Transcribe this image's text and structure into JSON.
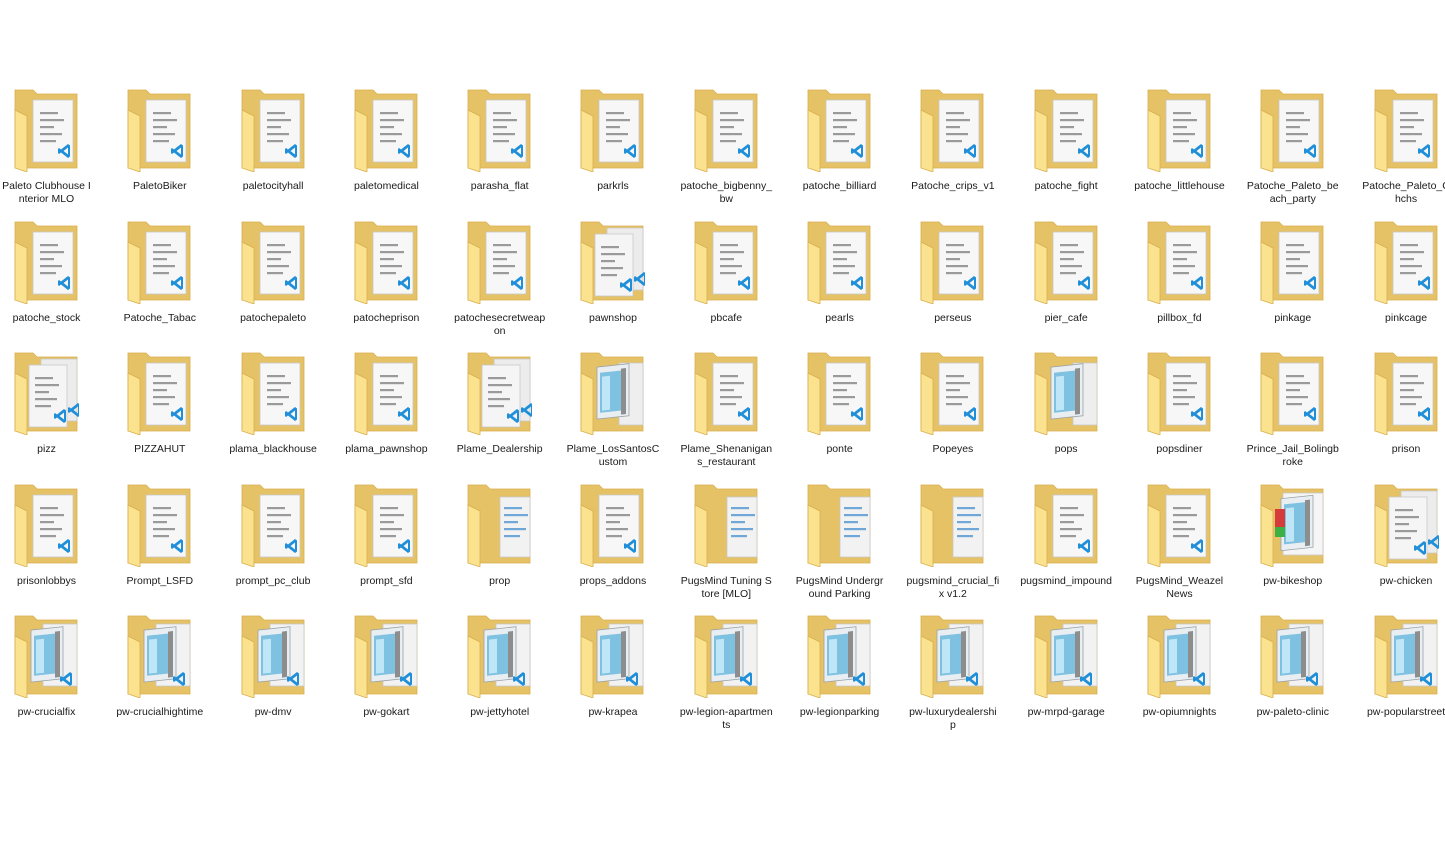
{
  "colors": {
    "folder_back": "#e6c267",
    "folder_front": "#fbe28f",
    "folder_edge": "#d8ae4c",
    "vscode_blue": "#1e8fd8",
    "label_text": "#1a1a1a"
  },
  "items": [
    {
      "name": "Paleto Clubhouse Interior MLO",
      "icon": "vscode"
    },
    {
      "name": "PaletoBiker",
      "icon": "vscode"
    },
    {
      "name": "paletocityhall",
      "icon": "vscode"
    },
    {
      "name": "paletomedical",
      "icon": "vscode"
    },
    {
      "name": "parasha_flat",
      "icon": "vscode"
    },
    {
      "name": "parkrls",
      "icon": "vscode"
    },
    {
      "name": "patoche_bigbenny_bw",
      "icon": "vscode"
    },
    {
      "name": "patoche_billiard",
      "icon": "vscode"
    },
    {
      "name": "Patoche_crips_v1",
      "icon": "vscode"
    },
    {
      "name": "patoche_fight",
      "icon": "vscode"
    },
    {
      "name": "patoche_littlehouse",
      "icon": "vscode"
    },
    {
      "name": "Patoche_Paleto_beach_party",
      "icon": "vscode"
    },
    {
      "name": "Patoche_Paleto_Chchs",
      "icon": "vscode"
    },
    {
      "name": "patoche_stock",
      "icon": "vscode"
    },
    {
      "name": "Patoche_Tabac",
      "icon": "vscode"
    },
    {
      "name": "patochepaleto",
      "icon": "vscode"
    },
    {
      "name": "patocheprison",
      "icon": "vscode"
    },
    {
      "name": "patochesecretweapon",
      "icon": "vscode"
    },
    {
      "name": "pawnshop",
      "icon": "vscode-multi"
    },
    {
      "name": "pbcafe",
      "icon": "vscode"
    },
    {
      "name": "pearls",
      "icon": "vscode"
    },
    {
      "name": "perseus",
      "icon": "vscode"
    },
    {
      "name": "pier_cafe",
      "icon": "vscode"
    },
    {
      "name": "pillbox_fd",
      "icon": "vscode"
    },
    {
      "name": "pinkage",
      "icon": "vscode"
    },
    {
      "name": "pinkcage",
      "icon": "vscode"
    },
    {
      "name": "pizz",
      "icon": "vscode-multi"
    },
    {
      "name": "PIZZAHUT",
      "icon": "vscode"
    },
    {
      "name": "plama_blackhouse",
      "icon": "vscode"
    },
    {
      "name": "plama_pawnshop",
      "icon": "vscode"
    },
    {
      "name": "Plame_Dealership",
      "icon": "vscode-multi"
    },
    {
      "name": "Plame_LosSantosCustom",
      "icon": "notepad"
    },
    {
      "name": "Plame_Shenanigans_restaurant",
      "icon": "vscode"
    },
    {
      "name": "ponte",
      "icon": "vscode"
    },
    {
      "name": "Popeyes",
      "icon": "vscode"
    },
    {
      "name": "pops",
      "icon": "notepad"
    },
    {
      "name": "popsdiner",
      "icon": "vscode"
    },
    {
      "name": "Prince_Jail_Bolingbroke",
      "icon": "vscode"
    },
    {
      "name": "prison",
      "icon": "vscode"
    },
    {
      "name": "prisonlobbys",
      "icon": "vscode"
    },
    {
      "name": "Prompt_LSFD",
      "icon": "vscode"
    },
    {
      "name": "prompt_pc_club",
      "icon": "vscode"
    },
    {
      "name": "prompt_sfd",
      "icon": "vscode"
    },
    {
      "name": "prop",
      "icon": "docs"
    },
    {
      "name": "props_addons",
      "icon": "vscode"
    },
    {
      "name": "PugsMind Tuning Store [MLO]",
      "icon": "docs"
    },
    {
      "name": "PugsMind Underground Parking",
      "icon": "docs"
    },
    {
      "name": "pugsmind_crucial_fix v1.2",
      "icon": "docs"
    },
    {
      "name": "pugsmind_impound",
      "icon": "vscode"
    },
    {
      "name": "PugsMind_WeazelNews",
      "icon": "vscode"
    },
    {
      "name": "pw-bikeshop",
      "icon": "notepad-color"
    },
    {
      "name": "pw-chicken",
      "icon": "vscode-multi"
    },
    {
      "name": "pw-crucialfix",
      "icon": "notepad-vscode"
    },
    {
      "name": "pw-crucialhightime",
      "icon": "notepad-vscode"
    },
    {
      "name": "pw-dmv",
      "icon": "notepad-vscode"
    },
    {
      "name": "pw-gokart",
      "icon": "notepad-vscode"
    },
    {
      "name": "pw-jettyhotel",
      "icon": "notepad-vscode"
    },
    {
      "name": "pw-krapea",
      "icon": "notepad-vscode"
    },
    {
      "name": "pw-legion-apartments",
      "icon": "notepad-vscode"
    },
    {
      "name": "pw-legionparking",
      "icon": "notepad-vscode"
    },
    {
      "name": "pw-luxurydealership",
      "icon": "notepad-vscode"
    },
    {
      "name": "pw-mrpd-garage",
      "icon": "notepad-vscode"
    },
    {
      "name": "pw-opiumnights",
      "icon": "notepad-vscode"
    },
    {
      "name": "pw-paleto-clinic",
      "icon": "notepad-vscode"
    },
    {
      "name": "pw-popularstreet",
      "icon": "notepad-vscode"
    }
  ]
}
